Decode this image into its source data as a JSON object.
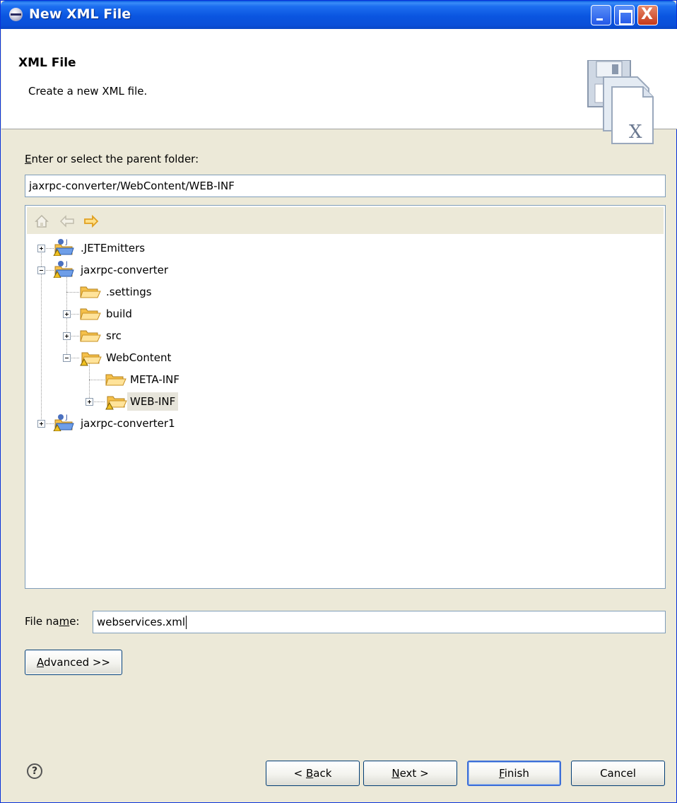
{
  "window": {
    "title": "New XML File",
    "controls": {
      "minimize_icon": "minimize-icon",
      "maximize_icon": "maximize-icon",
      "close_glyph": "X"
    }
  },
  "banner": {
    "title": "XML File",
    "description": "Create a new XML file.",
    "icon": "xml-file-wizard-icon"
  },
  "parent_folder": {
    "label_prefix": "",
    "label_mnemonic": "E",
    "label_rest": "nter or select the parent folder:",
    "value": "jaxrpc-converter/WebContent/WEB-INF"
  },
  "tree_toolbar": [
    "home-icon",
    "back-arrow-icon",
    "forward-arrow-icon"
  ],
  "tree": [
    {
      "label": ".JETEmitters",
      "icon": "project-folder-icon",
      "expander": "plus"
    },
    {
      "label": "jaxrpc-converter",
      "icon": "project-folder-icon",
      "expander": "minus"
    },
    {
      "label": ".settings",
      "icon": "folder-icon",
      "expander": "none"
    },
    {
      "label": "build",
      "icon": "folder-icon",
      "expander": "plus"
    },
    {
      "label": "src",
      "icon": "folder-icon",
      "expander": "plus"
    },
    {
      "label": "WebContent",
      "icon": "warning-folder-icon",
      "expander": "minus"
    },
    {
      "label": "META-INF",
      "icon": "folder-icon",
      "expander": "none"
    },
    {
      "label": "WEB-INF",
      "icon": "warning-folder-icon",
      "expander": "plus",
      "selected": true
    },
    {
      "label": "jaxrpc-converter1",
      "icon": "project-folder-icon",
      "expander": "plus"
    }
  ],
  "file_name": {
    "label_prefix": "File na",
    "label_mnemonic": "m",
    "label_rest": "e:",
    "value": "webservices.xml"
  },
  "advanced_button": {
    "mnemonic": "A",
    "rest": "dvanced >>"
  },
  "footer": {
    "help_glyph": "?",
    "back": {
      "prefix": "< ",
      "mnemonic": "B",
      "rest": "ack"
    },
    "next": {
      "prefix": "",
      "mnemonic": "N",
      "rest": "ext >"
    },
    "finish": {
      "prefix": "",
      "mnemonic": "F",
      "rest": "inish"
    },
    "cancel": {
      "label": "Cancel"
    }
  },
  "colors": {
    "titlebar": "#0a55e0",
    "dialog_bg": "#ece9d8",
    "folder_yellow": "#f5c04a",
    "selection_bg": "#e6e4da",
    "nav_arrow": "#f0a020"
  }
}
